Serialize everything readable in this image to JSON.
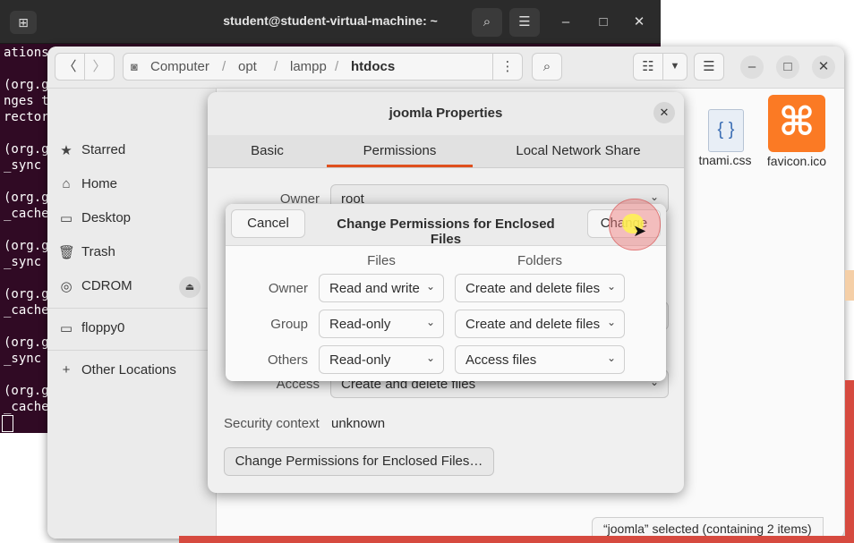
{
  "terminal": {
    "title": "student@student-virtual-machine: ~",
    "lines": [
      "ations",
      "",
      "(org.g",
      "nges t",
      "rector",
      "",
      "(org.g",
      "_sync",
      "",
      "(org.g",
      "_cache",
      "",
      "(org.g",
      "_sync",
      "",
      "(org.g",
      "_cache",
      "",
      "(org.g",
      "_sync",
      "",
      "(org.g",
      "_cache"
    ]
  },
  "files": {
    "path": [
      "Computer",
      "opt",
      "lampp",
      "htdocs"
    ],
    "sidebar": [
      {
        "icon": "star-icon",
        "glyph": "★",
        "label": "Starred"
      },
      {
        "icon": "home-icon",
        "glyph": "⌂",
        "label": "Home"
      },
      {
        "icon": "desktop-icon",
        "glyph": "▭",
        "label": "Desktop"
      },
      {
        "icon": "trash-icon",
        "glyph": "🗑",
        "label": "Trash"
      },
      {
        "icon": "disc-icon",
        "glyph": "◎",
        "label": "CDROM"
      },
      {
        "icon": "floppy-icon",
        "glyph": "▭",
        "label": "floppy0"
      },
      {
        "icon": "plus-icon",
        "glyph": "+",
        "label": "Other Locations"
      }
    ],
    "items": [
      {
        "name": "tnami.css",
        "icon": "css-file-icon"
      },
      {
        "name": "favicon.ico",
        "icon": "favicon-file-icon"
      }
    ],
    "status": "“joomla” selected  (containing 2 items)"
  },
  "properties": {
    "title": "joomla Properties",
    "tabs": [
      "Basic",
      "Permissions",
      "Local Network Share"
    ],
    "active_tab": "Permissions",
    "owner_label": "Owner",
    "owner_value": "root",
    "access_label": "Access",
    "access_value": "Create and delete files",
    "security_label": "Security context",
    "security_value": "unknown",
    "enclosed_button": "Change Permissions for Enclosed Files…"
  },
  "change_dialog": {
    "cancel": "Cancel",
    "title": "Change Permissions for Enclosed Files",
    "change": "Change",
    "col_files": "Files",
    "col_folders": "Folders",
    "rows": [
      {
        "label": "Owner",
        "files": "Read and write",
        "folders": "Create and delete files"
      },
      {
        "label": "Group",
        "files": "Read-only",
        "folders": "Create and delete files"
      },
      {
        "label": "Others",
        "files": "Read-only",
        "folders": "Access files"
      }
    ]
  },
  "colors": {
    "accent": "#e95420",
    "terminal_bg": "#300a24",
    "favicon": "#fb7a24"
  }
}
